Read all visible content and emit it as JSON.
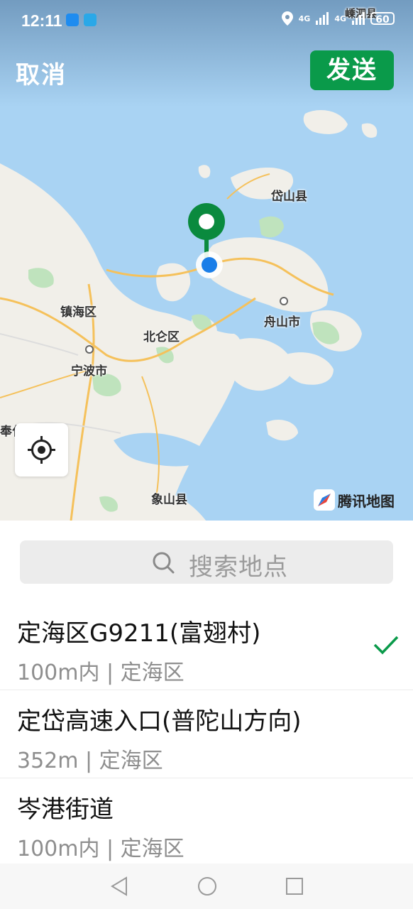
{
  "status_bar": {
    "time": "12:11",
    "signal1": "4G",
    "signal2": "4G",
    "battery": "60",
    "app_icon_colors": [
      "#1e8cf0",
      "#2aa8e8"
    ]
  },
  "header": {
    "cancel_label": "取消",
    "send_label": "发送",
    "send_color": "#0a9a4a"
  },
  "map": {
    "labels": {
      "daishan": "岱山县",
      "zhoushan": "舟山市",
      "zhenhai": "镇海区",
      "beilun": "北仑区",
      "ningbo": "宁波市",
      "fenghua": "奉化区",
      "xiangshan": "象山县",
      "shengsi": "嵊泗县"
    },
    "brand": "腾讯地图",
    "pin_color": "#0a8a3e",
    "location_dot_color": "#1a7ee8",
    "icons": [
      "map-pin-icon",
      "current-location-dot-icon",
      "locate-icon",
      "tencent-map-logo-icon"
    ]
  },
  "search": {
    "placeholder": "搜索地点",
    "icon": "search-icon"
  },
  "results": [
    {
      "title": "定海区G9211(富翅村)",
      "subtitle": "100m内 | 定海区",
      "selected": true
    },
    {
      "title": "定岱高速入口(普陀山方向)",
      "subtitle": "352m | 定海区",
      "selected": false
    },
    {
      "title": "岑港街道",
      "subtitle": "100m内 | 定海区",
      "selected": false
    }
  ],
  "nav_bar": {
    "icons": [
      "back-triangle-icon",
      "home-circle-icon",
      "recents-square-icon"
    ]
  }
}
